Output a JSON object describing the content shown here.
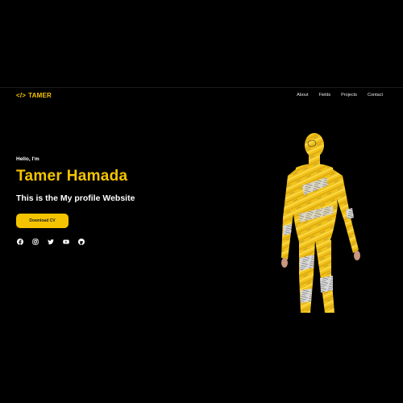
{
  "brand": {
    "code_symbol": "</>",
    "name": "TAMER"
  },
  "nav": {
    "items": [
      "About",
      "Fields",
      "Projects",
      "Contact"
    ]
  },
  "hero": {
    "greeting": "Hello, I'm",
    "name": "Tamer Hamada",
    "tagline": "This is the My profile Website",
    "cta_label": "Download CV"
  },
  "socials": [
    "facebook-icon",
    "instagram-icon",
    "twitter-icon",
    "youtube-icon",
    "github-icon"
  ],
  "colors": {
    "accent": "#f5c400",
    "background": "#000000"
  }
}
